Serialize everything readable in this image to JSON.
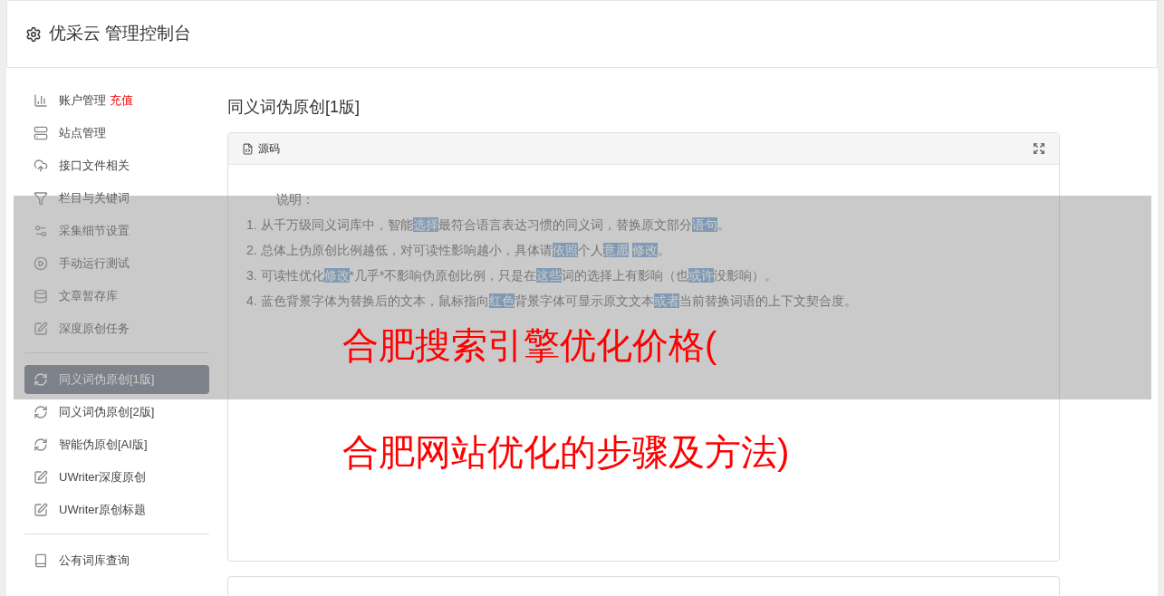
{
  "header": {
    "title": "优采云 管理控制台"
  },
  "sidebar": {
    "groups": [
      {
        "items": [
          {
            "label": "账户管理",
            "badge": "充值",
            "selected": false
          },
          {
            "label": "站点管理",
            "selected": false
          },
          {
            "label": "接口文件相关",
            "selected": false
          },
          {
            "label": "栏目与关键词",
            "selected": false
          },
          {
            "label": "采集细节设置",
            "selected": false
          },
          {
            "label": "手动运行测试",
            "selected": false
          },
          {
            "label": "文章暂存库",
            "selected": false
          },
          {
            "label": "深度原创任务",
            "selected": false
          }
        ]
      },
      {
        "items": [
          {
            "label": "同义词伪原创[1版]",
            "selected": true
          },
          {
            "label": "同义词伪原创[2版]",
            "selected": false
          },
          {
            "label": "智能伪原创[AI版]",
            "selected": false
          },
          {
            "label": "UWriter深度原创",
            "selected": false
          },
          {
            "label": "UWriter原创标题",
            "selected": false
          }
        ]
      },
      {
        "items": [
          {
            "label": "公有词库查询",
            "selected": false
          }
        ]
      }
    ]
  },
  "content": {
    "title": "同义词伪原创[1版]",
    "panel": {
      "tab": "源码",
      "intro": "说明：",
      "lines": [
        [
          {
            "text": "1. 从千万级同义词库中，智能",
            "highlighted": false
          },
          {
            "text": "选择",
            "highlighted": true
          },
          {
            "text": "最符合语言表达习惯的同义词，替换原文部分",
            "highlighted": false
          },
          {
            "text": "语句",
            "highlighted": true
          },
          {
            "text": "。",
            "highlighted": false
          }
        ],
        [
          {
            "text": "2. 总体上伪原创比例越低，对可读性影响越小，具体请",
            "highlighted": false
          },
          {
            "text": "依照",
            "highlighted": true
          },
          {
            "text": "个人",
            "highlighted": false
          },
          {
            "text": "意愿",
            "highlighted": true
          },
          {
            "text": "修改",
            "highlighted": true
          },
          {
            "text": "。",
            "highlighted": false
          }
        ],
        [
          {
            "text": "3. 可读性优化",
            "highlighted": false
          },
          {
            "text": "修改",
            "highlighted": true
          },
          {
            "text": "*几乎*不影响伪原创比例，只是在",
            "highlighted": false
          },
          {
            "text": "这些",
            "highlighted": true
          },
          {
            "text": "词的选择上有影响（也",
            "highlighted": false
          },
          {
            "text": "或许",
            "highlighted": true
          },
          {
            "text": "没影响）。",
            "highlighted": false
          }
        ],
        [
          {
            "text": "4. 蓝色背景字体为替换后的文本，鼠标指向",
            "highlighted": false
          },
          {
            "text": "红色",
            "highlighted": true
          },
          {
            "text": "背景字体可显示原文文本",
            "highlighted": false
          },
          {
            "text": "或者",
            "highlighted": true
          },
          {
            "text": "当前替换词语的上下文契合度。",
            "highlighted": false
          }
        ]
      ]
    }
  },
  "overlay_caption": [
    "合肥搜索引擎优化价格(",
    "合肥网站优化的步骤及方法)"
  ]
}
